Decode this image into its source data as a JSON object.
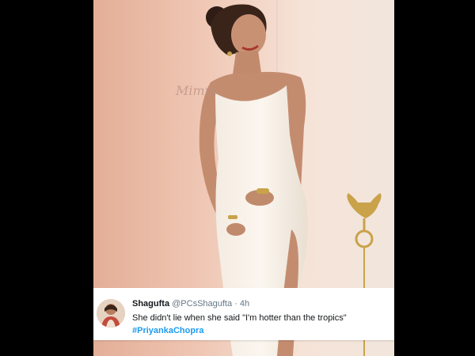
{
  "tweet": {
    "display_name": "Shagufta",
    "handle": "@PCsShagufta",
    "separator": " · ",
    "time": "4h",
    "text": "She didn't lie when she said \"I'm hotter than the tropics\"",
    "hashtag": "#PriyankaChopra"
  },
  "photo": {
    "watermark": "Mimm"
  },
  "colors": {
    "hashtag": "#1d9bf0",
    "handle": "#657786",
    "background": "#000000"
  }
}
